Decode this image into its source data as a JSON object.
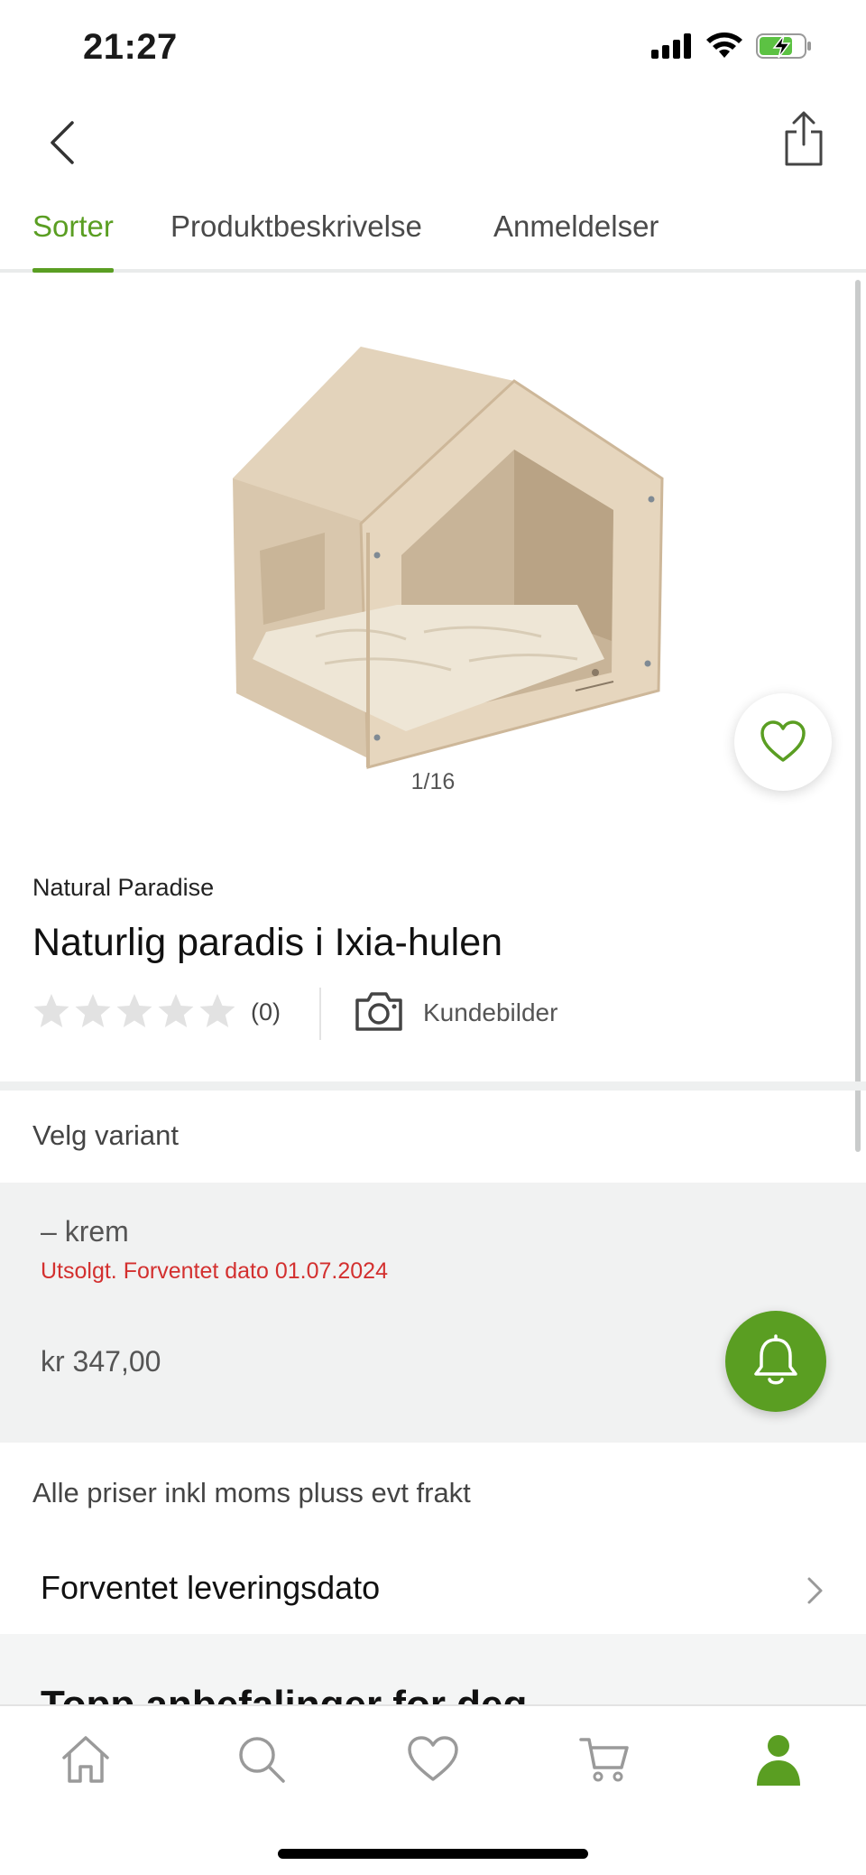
{
  "status_bar": {
    "time": "21:27"
  },
  "tabs": [
    {
      "label": "Sorter",
      "active": true
    },
    {
      "label": "Produktbeskrivelse",
      "active": false
    },
    {
      "label": "Anmeldelser",
      "active": false
    }
  ],
  "gallery": {
    "counter": "1/16",
    "image_subject": "wooden pet house with cushion"
  },
  "product": {
    "brand": "Natural Paradise",
    "title": "Naturlig paradis i Ixia-hulen",
    "rating": 0,
    "rating_count": "(0)",
    "customer_images_label": "Kundebilder"
  },
  "variant": {
    "heading": "Velg variant",
    "name": "– krem",
    "status": "Utsolgt. Forventet dato 01.07.2024",
    "price": "kr 347,00"
  },
  "price_note": "Alle priser inkl moms pluss evt frakt",
  "delivery_label": "Forventet leveringsdato",
  "recommendations_title": "Topp anbefalinger for deg",
  "bottom_nav": [
    "home-icon",
    "search-icon",
    "heart-icon",
    "cart-icon",
    "profile-icon"
  ],
  "colors": {
    "accent": "#5a9e22",
    "error": "#d3302f",
    "variant_bg": "#f1f2f2"
  }
}
